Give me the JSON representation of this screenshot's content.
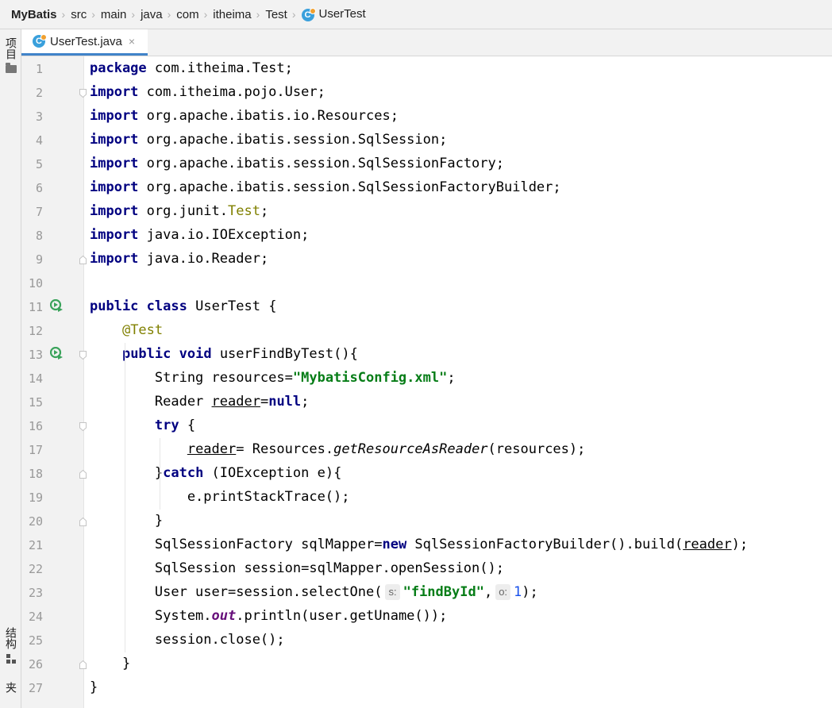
{
  "breadcrumb": [
    {
      "label": "MyBatis",
      "bold": true
    },
    {
      "label": "src"
    },
    {
      "label": "main"
    },
    {
      "label": "java"
    },
    {
      "label": "com"
    },
    {
      "label": "itheima"
    },
    {
      "label": "Test"
    },
    {
      "label": "UserTest",
      "icon": "class-icon"
    }
  ],
  "left_toolwindows": {
    "project_label": "项目",
    "structure_label": "结构",
    "bookmarks_label": "收藏夹"
  },
  "tab": {
    "label": "UserTest.java",
    "icon": "class-icon",
    "close": "×"
  },
  "colors": {
    "keyword": "#000080",
    "string": "#067d17",
    "annotation": "#808000",
    "static_field": "#660e7a",
    "number": "#1750eb",
    "caret_line": "#fdfbe6",
    "tab_underline": "#4083c9"
  },
  "editor": {
    "highlighted_line": 9,
    "lines": [
      {
        "n": "1",
        "tokens": [
          {
            "t": "package",
            "c": "kw"
          },
          {
            "t": " com.itheima.Test;"
          }
        ]
      },
      {
        "n": "2",
        "fold": "open",
        "tokens": [
          {
            "t": "import",
            "c": "kw"
          },
          {
            "t": " com.itheima.pojo.User;"
          }
        ]
      },
      {
        "n": "3",
        "tokens": [
          {
            "t": "import",
            "c": "kw"
          },
          {
            "t": " org.apache.ibatis.io.Resources;"
          }
        ]
      },
      {
        "n": "4",
        "tokens": [
          {
            "t": "import",
            "c": "kw"
          },
          {
            "t": " org.apache.ibatis.session.SqlSession;"
          }
        ]
      },
      {
        "n": "5",
        "tokens": [
          {
            "t": "import",
            "c": "kw"
          },
          {
            "t": " org.apache.ibatis.session.SqlSessionFactory;"
          }
        ]
      },
      {
        "n": "6",
        "tokens": [
          {
            "t": "import",
            "c": "kw"
          },
          {
            "t": " org.apache.ibatis.session.SqlSessionFactoryBuilder;"
          }
        ]
      },
      {
        "n": "7",
        "tokens": [
          {
            "t": "import",
            "c": "kw"
          },
          {
            "t": " org.junit."
          },
          {
            "t": "Test",
            "c": "yel"
          },
          {
            "t": ";"
          }
        ]
      },
      {
        "n": "8",
        "tokens": [
          {
            "t": "import",
            "c": "kw"
          },
          {
            "t": " java.io.IOException;"
          }
        ]
      },
      {
        "n": "9",
        "fold": "close",
        "tokens": [
          {
            "t": "import",
            "c": "kw"
          },
          {
            "t": " java.io.Reader;"
          }
        ]
      },
      {
        "n": "10",
        "tokens": []
      },
      {
        "n": "11",
        "run": true,
        "tokens": [
          {
            "t": "public",
            "c": "kw"
          },
          {
            "t": " "
          },
          {
            "t": "class",
            "c": "kw"
          },
          {
            "t": " UserTest {"
          }
        ]
      },
      {
        "n": "12",
        "tokens": [
          {
            "t": "    "
          },
          {
            "t": "@Test",
            "c": "ann"
          }
        ]
      },
      {
        "n": "13",
        "run": true,
        "fold": "open",
        "tokens": [
          {
            "t": "    "
          },
          {
            "t": "public",
            "c": "kw"
          },
          {
            "t": " "
          },
          {
            "t": "void",
            "c": "kw"
          },
          {
            "t": " userFindByTest(){"
          }
        ]
      },
      {
        "n": "14",
        "tokens": [
          {
            "t": "        String resources="
          },
          {
            "t": "\"MybatisConfig.xml\"",
            "c": "str"
          },
          {
            "t": ";"
          }
        ]
      },
      {
        "n": "15",
        "tokens": [
          {
            "t": "        Reader "
          },
          {
            "t": "reader",
            "c": "ul"
          },
          {
            "t": "="
          },
          {
            "t": "null",
            "c": "kw"
          },
          {
            "t": ";"
          }
        ]
      },
      {
        "n": "16",
        "fold": "open",
        "tokens": [
          {
            "t": "        "
          },
          {
            "t": "try",
            "c": "kw"
          },
          {
            "t": " {"
          }
        ]
      },
      {
        "n": "17",
        "tokens": [
          {
            "t": "            "
          },
          {
            "t": "reader",
            "c": "ul"
          },
          {
            "t": "= Resources."
          },
          {
            "t": "getResourceAsReader",
            "c": "italic"
          },
          {
            "t": "(resources);"
          }
        ]
      },
      {
        "n": "18",
        "fold": "close",
        "tokens": [
          {
            "t": "        }"
          },
          {
            "t": "catch",
            "c": "kw"
          },
          {
            "t": " (IOException e){"
          }
        ]
      },
      {
        "n": "19",
        "tokens": [
          {
            "t": "            e.printStackTrace();"
          }
        ]
      },
      {
        "n": "20",
        "fold": "close",
        "tokens": [
          {
            "t": "        }"
          }
        ]
      },
      {
        "n": "21",
        "tokens": [
          {
            "t": "        SqlSessionFactory sqlMapper="
          },
          {
            "t": "new",
            "c": "kw"
          },
          {
            "t": " SqlSessionFactoryBuilder().build("
          },
          {
            "t": "reader",
            "c": "ul"
          },
          {
            "t": ");"
          }
        ]
      },
      {
        "n": "22",
        "tokens": [
          {
            "t": "        SqlSession session=sqlMapper.openSession();"
          }
        ]
      },
      {
        "n": "23",
        "tokens": [
          {
            "t": "        User user=session.selectOne("
          },
          {
            "t": "s:",
            "c": "hint"
          },
          {
            "t": "\"findById\"",
            "c": "str"
          },
          {
            "t": ","
          },
          {
            "t": "o:",
            "c": "hint"
          },
          {
            "t": "1",
            "c": "num"
          },
          {
            "t": ");"
          }
        ]
      },
      {
        "n": "24",
        "tokens": [
          {
            "t": "        System."
          },
          {
            "t": "out",
            "c": "static"
          },
          {
            "t": ".println(user.getUname());"
          }
        ]
      },
      {
        "n": "25",
        "tokens": [
          {
            "t": "        session.close();"
          }
        ]
      },
      {
        "n": "26",
        "fold": "close",
        "tokens": [
          {
            "t": "    }"
          }
        ]
      },
      {
        "n": "27",
        "tokens": [
          {
            "t": "}"
          }
        ]
      }
    ]
  }
}
